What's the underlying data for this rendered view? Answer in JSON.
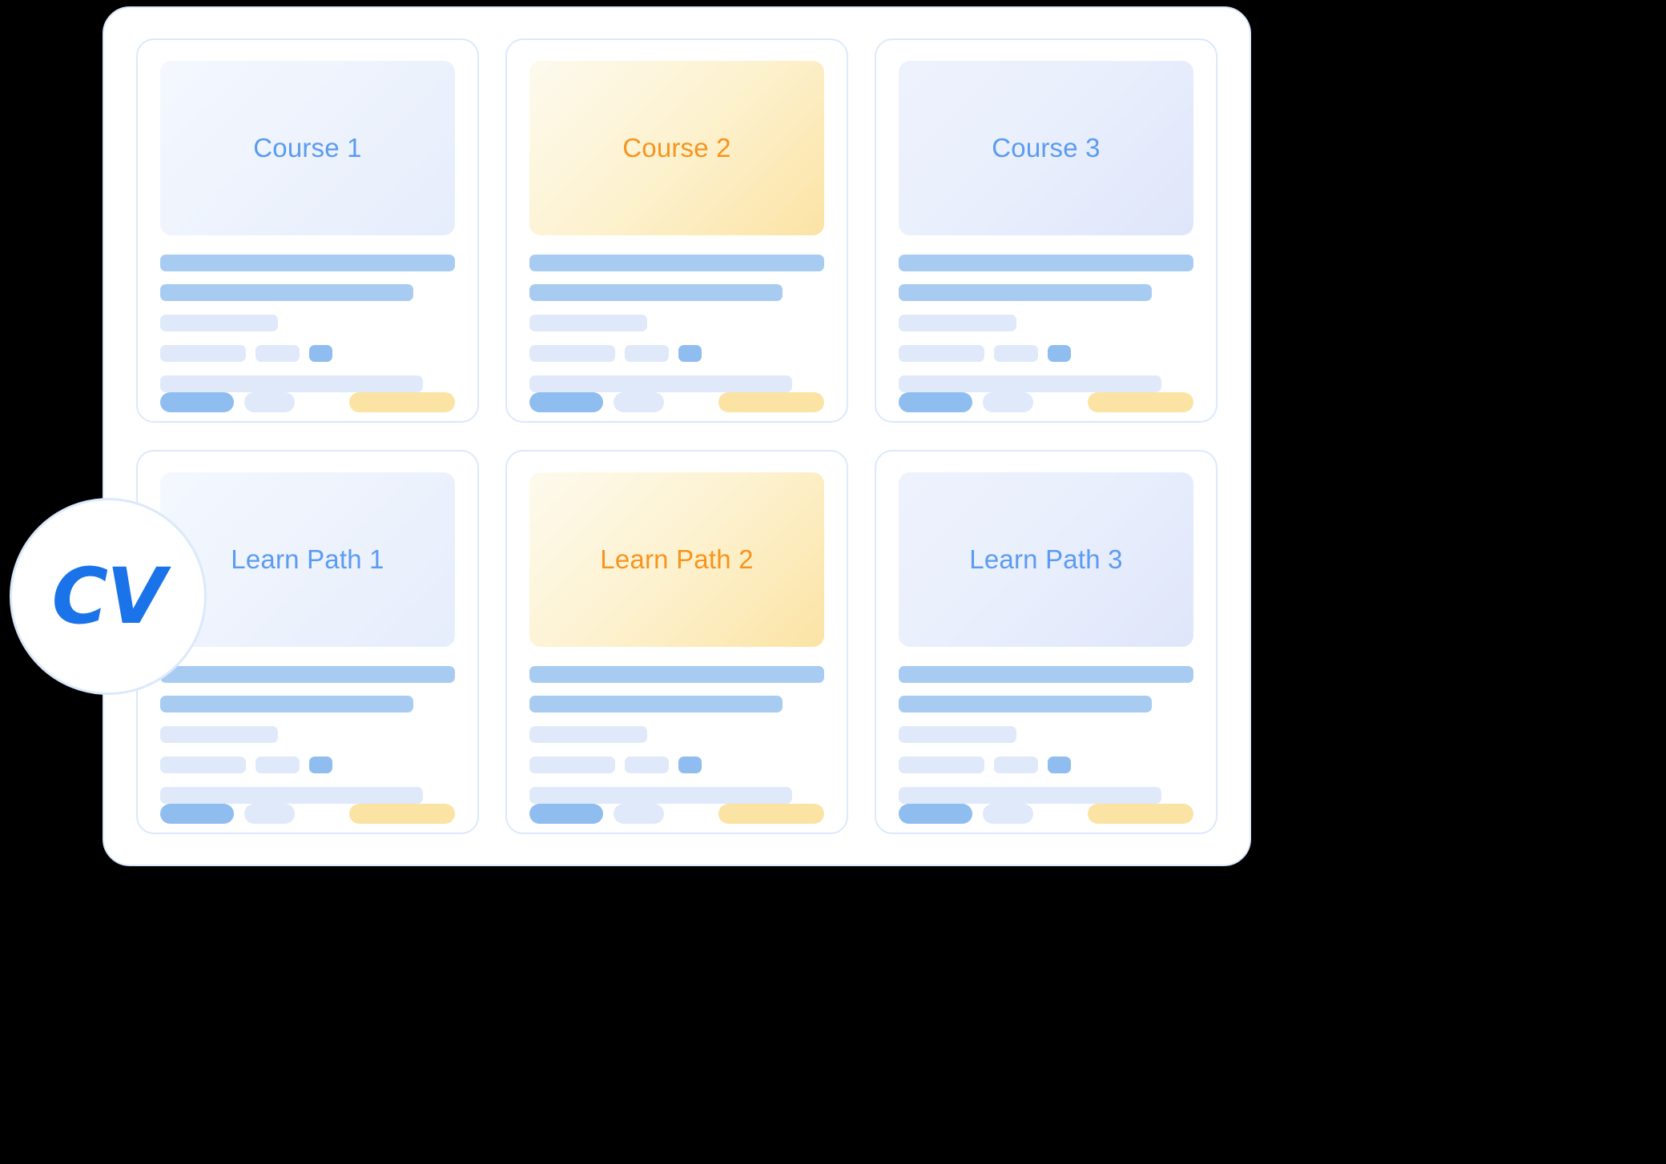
{
  "brand": {
    "logo_text": "CV",
    "logo_color": "#1a73e8",
    "border_color": "#dbe9fb"
  },
  "palette": {
    "title_blue": "#5b9bf0",
    "title_orange": "#f7941d",
    "bar_strong": "#a8cbf2",
    "bar_soft": "#dfe9f9",
    "bar_accent": "#8fbdf0",
    "bar_yellow": "#fbe3a4"
  },
  "grid": {
    "rows": [
      {
        "name": "courses-row",
        "cards": [
          {
            "title": "Course 1",
            "title_style": "blue",
            "thumb_style": "blue-a"
          },
          {
            "title": "Course 2",
            "title_style": "orange",
            "thumb_style": "yellow"
          },
          {
            "title": "Course 3",
            "title_style": "blue",
            "thumb_style": "blue-b"
          }
        ]
      },
      {
        "name": "learning-paths-row",
        "cards": [
          {
            "title": "Learn Path 1",
            "title_style": "blue",
            "thumb_style": "blue-a"
          },
          {
            "title": "Learn Path 2",
            "title_style": "orange",
            "thumb_style": "yellow"
          },
          {
            "title": "Learn Path 3",
            "title_style": "blue",
            "thumb_style": "blue-b"
          }
        ]
      }
    ]
  }
}
